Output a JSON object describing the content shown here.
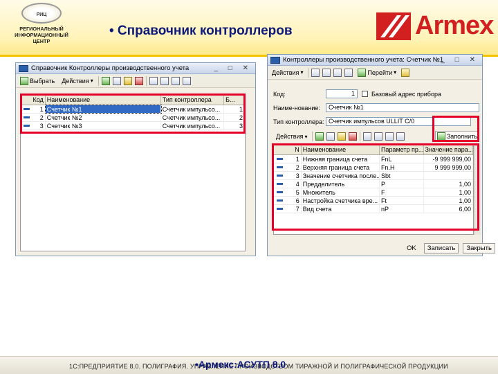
{
  "header": {
    "slide_title": "• Справочник контроллеров",
    "rc_logo": {
      "emblem_text": "РИЦ",
      "lines": [
        "РЕГИОНАЛЬНЫЙ",
        "ИНФОРМАЦИОННЫЙ",
        "ЦЕНТР"
      ]
    },
    "armex_logo": {
      "text": "Armex",
      "color": "#d22020"
    },
    "bar_color": "#f4c400"
  },
  "left_window": {
    "title": "Справочник Контроллеры производственного учета",
    "title_buttons": "_ □ ✕",
    "toolbar": {
      "select_label": "Выбрать",
      "actions_label": "Действия"
    },
    "columns": [
      "Код",
      "Наименование",
      "Тип контроллера",
      "Б..."
    ],
    "rows": [
      {
        "code": "1",
        "name": "Счетчик №1",
        "type": "Счетчик импульсо...",
        "b": "1"
      },
      {
        "code": "2",
        "name": "Счетчик №2",
        "type": "Счетчик импульсо...",
        "b": "2"
      },
      {
        "code": "3",
        "name": "Счетчик №3",
        "type": "Счетчик импульсо...",
        "b": "3"
      }
    ],
    "selected_row": 0
  },
  "right_window": {
    "title": "Контроллеры производственного учета: Счетчик №1",
    "title_buttons": "_ □ ✕",
    "toolbar": {
      "actions_label": "Действия",
      "goto_label": "Перейти"
    },
    "fields": {
      "code_label": "Код:",
      "code_value": "1",
      "base_address_label": "Базовый адрес прибора",
      "name_label": "Наиме-нование:",
      "name_value": "Счетчик №1",
      "type_label": "Тип контроллера:",
      "type_value": "Счетчик импульсов ULLIT C/0"
    },
    "table_toolbar": {
      "actions_label": "Действия",
      "fill_label": "Заполнить"
    },
    "columns": [
      "N",
      "Наименование",
      "Параметр пр...",
      "Значение пара..."
    ],
    "rows": [
      {
        "n": "1",
        "name": "Нижняя граница счета",
        "param": "FnL",
        "value": "-9 999 999,00"
      },
      {
        "n": "2",
        "name": "Верхняя граница счета",
        "param": "Fn.H",
        "value": "9 999 999,00"
      },
      {
        "n": "3",
        "name": "Значение счетчика после...",
        "param": "Sbt",
        "value": ""
      },
      {
        "n": "4",
        "name": "Предделитель",
        "param": "P",
        "value": "1,00"
      },
      {
        "n": "5",
        "name": "Множитель",
        "param": "F",
        "value": "1,00"
      },
      {
        "n": "6",
        "name": "Настройка счетчика вре...",
        "param": "Ft",
        "value": "1,00"
      },
      {
        "n": "7",
        "name": "Вид счета",
        "param": "nP",
        "value": "6,00"
      }
    ],
    "footer": {
      "ok_label": "OK",
      "save_label": "Записать",
      "close_label": "Закрыть"
    }
  },
  "bottom": {
    "strip_text": "1С:ПРЕДПРИЯТИЕ 8.0. ПОЛИГРАФИЯ. УПРАВЛЕНИЕ ПРОИЗВОДСТВОМ ТИРАЖНОЙ И ПОЛИГРАФИЧЕСКОЙ ПРОДУКЦИИ",
    "overlay_text": "•Армекс:АСУТП 8.0"
  },
  "colors": {
    "highlight": "#e5002a",
    "selection": "#316ac5",
    "title_text": "#0d1a7a"
  }
}
